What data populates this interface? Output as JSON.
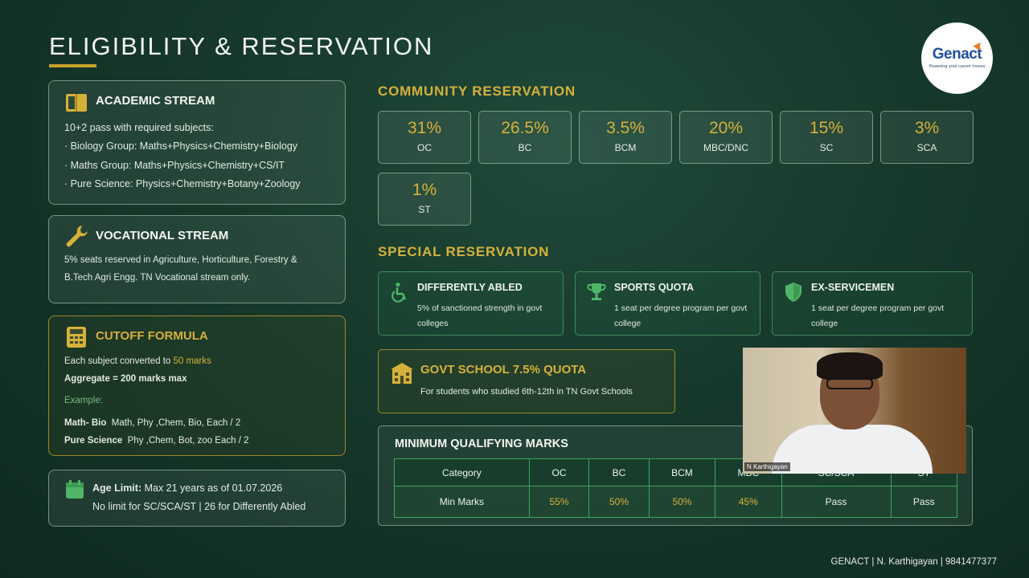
{
  "header": {
    "title": "ELIGIBILITY & RESERVATION",
    "logo_text": "Genact",
    "logo_tagline": "Powering your career moves"
  },
  "academic": {
    "title": "ACADEMIC STREAM",
    "intro": "10+2 pass with required subjects:",
    "items": [
      "Biology Group: Maths+Physics+Chemistry+Biology",
      "Maths Group: Maths+Physics+Chemistry+CS/IT",
      "Pure Science: Physics+Chemistry+Botany+Zoology"
    ]
  },
  "vocational": {
    "title": "VOCATIONAL STREAM",
    "line1": "5% seats reserved in Agriculture, Horticulture, Forestry &",
    "line2": "B.Tech Agri Engg. TN Vocational stream only."
  },
  "cutoff": {
    "title": "CUTOFF FORMULA",
    "line1_prefix": "Each subject converted to ",
    "line1_highlight": "50 marks",
    "line2": "Aggregate = 200 marks max",
    "example_label": "Example:",
    "ex1_label": "Math- Bio",
    "ex1_text": "Math, Phy ,Chem, Bio, Each / 2",
    "ex2_label": "Pure Science",
    "ex2_text": "Phy ,Chem, Bot, zoo  Each / 2"
  },
  "age": {
    "label": "Age Limit:",
    "text": "Max 21 years as of 01.07.2026",
    "line2": "No limit for SC/SCA/ST | 26 for Differently Abled"
  },
  "community": {
    "title": "COMMUNITY RESERVATION",
    "tiles": [
      {
        "pct": "31%",
        "label": "OC"
      },
      {
        "pct": "26.5%",
        "label": "BC"
      },
      {
        "pct": "3.5%",
        "label": "BCM"
      },
      {
        "pct": "20%",
        "label": "MBC/DNC"
      },
      {
        "pct": "15%",
        "label": "SC"
      },
      {
        "pct": "3%",
        "label": "SCA"
      },
      {
        "pct": "1%",
        "label": "ST"
      }
    ]
  },
  "special": {
    "title": "SPECIAL RESERVATION",
    "cards": [
      {
        "title": "DIFFERENTLY ABLED",
        "desc": "5% of sanctioned strength in govt colleges",
        "icon": "wheelchair-icon"
      },
      {
        "title": "SPORTS QUOTA",
        "desc": "1 seat per degree program per govt college",
        "icon": "trophy-icon"
      },
      {
        "title": "EX-SERVICEMEN",
        "desc": "1 seat per degree program per govt college",
        "icon": "shield-icon"
      }
    ]
  },
  "govt": {
    "title": "GOVT SCHOOL 7.5% QUOTA",
    "desc": "For students who studied 6th-12th in TN Govt Schools"
  },
  "min_marks": {
    "title": "MINIMUM QUALIFYING MARKS",
    "headers": [
      "Category",
      "OC",
      "BC",
      "BCM",
      "MBC",
      "SC/SCA",
      "ST"
    ],
    "row_label": "Min Marks",
    "values": [
      "55%",
      "50%",
      "50%",
      "45%",
      "Pass",
      "Pass"
    ]
  },
  "webcam": {
    "name": "N Karthigayan"
  },
  "footer": {
    "text": "GENACT | N. Karthigayan | 9841477377"
  },
  "colors": {
    "accent_gold": "#d6b13a",
    "background": "#16382b",
    "table_border": "#3ca55c"
  }
}
